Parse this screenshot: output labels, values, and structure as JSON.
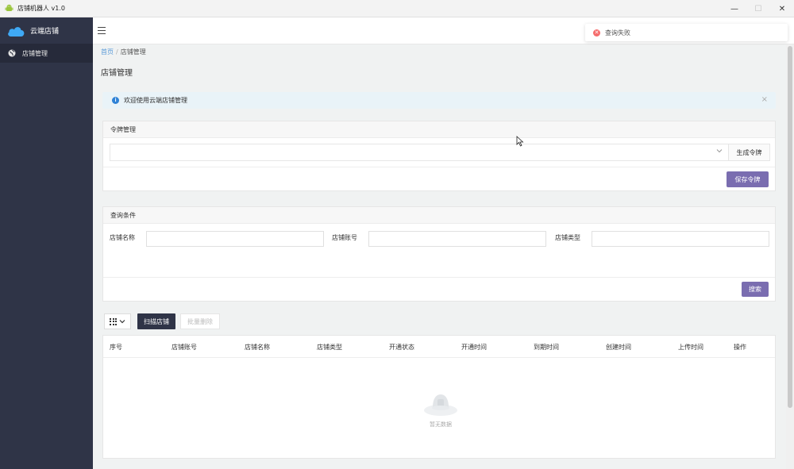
{
  "window": {
    "title": "店铺机器人 v1.0",
    "app_icon": "android-icon",
    "minimize": "—",
    "maximize": "☐",
    "close": "✕"
  },
  "sidebar": {
    "logo_text": "云端店铺",
    "logo_icon": "cloud-icon",
    "items": [
      {
        "label": "店铺管理",
        "icon": "globe-icon"
      }
    ]
  },
  "toast": {
    "text": "查询失败",
    "icon": "error-icon",
    "color": "#f56c6c"
  },
  "breadcrumb": {
    "home": "首页",
    "separator": "/",
    "current": "店铺管理"
  },
  "page_title": "店铺管理",
  "alert": {
    "text": "欢迎使用云端店铺管理",
    "close": "×"
  },
  "token_card": {
    "title": "令牌管理",
    "select_value": "",
    "generate_label": "生成令牌",
    "save_label": "保存令牌"
  },
  "query_card": {
    "title": "查询条件",
    "fields": [
      {
        "label": "店铺名称",
        "value": ""
      },
      {
        "label": "店铺账号",
        "value": ""
      },
      {
        "label": "店铺类型",
        "value": ""
      }
    ],
    "search_label": "搜索"
  },
  "toolbar": {
    "scan_label": "扫描店铺",
    "batch_delete_label": "批量删除"
  },
  "table": {
    "columns": [
      "序号",
      "店铺账号",
      "店铺名称",
      "店铺类型",
      "开通状态",
      "开通时间",
      "到期时间",
      "创建时间",
      "上传时间",
      "操作"
    ],
    "rows": [],
    "empty_text": "暂无数据"
  },
  "colors": {
    "sidebar_bg": "#2f3447",
    "primary_button": "#7a6db0",
    "dark_button": "#2f3447",
    "alert_bg": "#e9f3f8",
    "link": "#5a9bd8"
  }
}
